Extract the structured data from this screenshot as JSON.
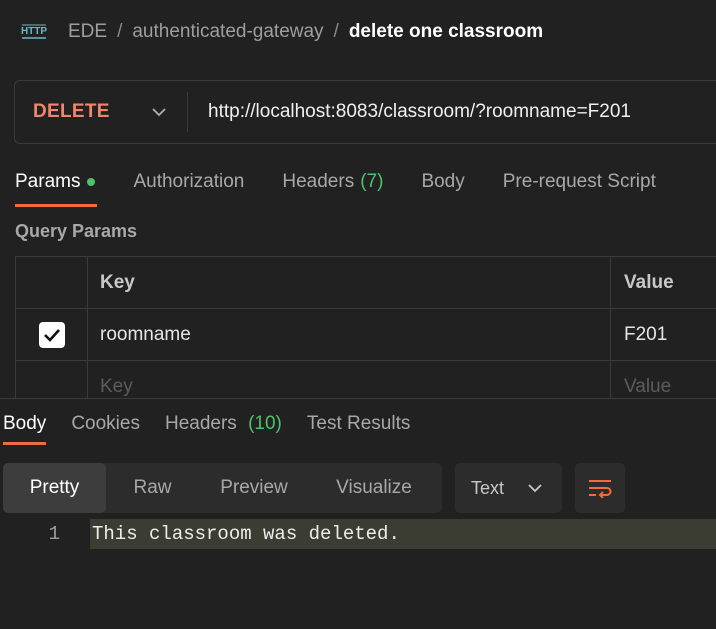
{
  "breadcrumb": {
    "icon": "http-icon",
    "workspace": "EDE",
    "separator": "/",
    "collection": "authenticated-gateway",
    "request": "delete one classroom"
  },
  "request": {
    "method": "DELETE",
    "method_color": "#f2866d",
    "url": "http://localhost:8083/classroom/?roomname=F201"
  },
  "request_tabs": {
    "params": "Params",
    "authorization": "Authorization",
    "headers": "Headers",
    "headers_count": "(7)",
    "body": "Body",
    "prerequest": "Pre-request Script"
  },
  "query_params": {
    "title": "Query Params",
    "header_key": "Key",
    "header_value": "Value",
    "rows": [
      {
        "checked": true,
        "key": "roomname",
        "value": "F201"
      }
    ],
    "placeholder_key": "Key",
    "placeholder_value": "Value"
  },
  "response_tabs": {
    "body": "Body",
    "cookies": "Cookies",
    "headers": "Headers",
    "headers_count": "(10)",
    "test_results": "Test Results"
  },
  "response_view": {
    "pretty": "Pretty",
    "raw": "Raw",
    "preview": "Preview",
    "visualize": "Visualize",
    "format": "Text"
  },
  "response_body": {
    "line_number": "1",
    "text": "This classroom was deleted."
  },
  "colors": {
    "accent": "#f26b3a",
    "success": "#4cc36a",
    "background": "#212121"
  }
}
